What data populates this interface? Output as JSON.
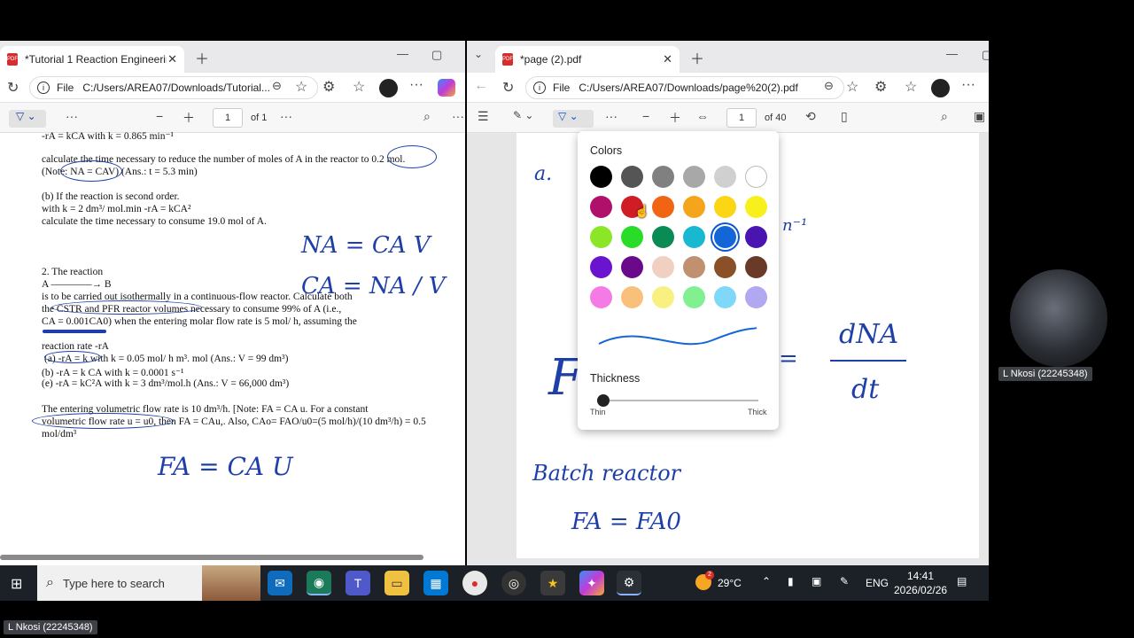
{
  "left_window": {
    "tab_title": "*Tutorial 1 Reaction Engineering (",
    "address_label": "File",
    "address": "C:/Users/AREA07/Downloads/Tutorial...",
    "page_current": "1",
    "page_total": "of 1"
  },
  "right_window": {
    "tab_title": "*page (2).pdf",
    "address_label": "File",
    "address": "C:/Users/AREA07/Downloads/page%20(2).pdf",
    "page_current": "1",
    "page_total": "of 40"
  },
  "left_doc": {
    "lines": [
      "-rA = kCA with k = 0.865 min⁻¹",
      "calculate the time necessary to reduce the number of moles of A in the reactor to 0.2 mol.",
      "(Note: NA = CAV) (Ans.: t = 5.3 min)",
      "(b) If the reaction is second order.",
      "with k = 2 dm³/ mol.min    -rA = kCA²",
      "calculate the time necessary to consume 19.0 mol of A.",
      "2. The reaction",
      "A ————→ B",
      "is to be carried out isothermally in a continuous-flow reactor. Calculate both",
      "the CSTR and PFR reactor volumes necessary to consume 99% of A (i.e.,",
      "CA = 0.001CA0) when the entering molar flow rate is 5 mol/ h, assuming the",
      "reaction rate -rA",
      "(a) -rA = k        with k = 0.05 mol/ h m³.    mol (Ans.: V = 99 dm³)",
      "(b) -rA = k CA  with k = 0.0001 s⁻¹",
      "(e) -rA = kC²A with k = 3 dm³/mol.h   (Ans.: V = 66,000 dm³)",
      "The entering volumetric flow rate is 10 dm³/h. [Note: FA = CA u. For a constant",
      "volumetric flow rate u = u0, then FA = CAu,. Also, CAo= FAO/u0=(5 mol/h)/(10 dm³/h) = 0.5",
      "mol/dm³"
    ],
    "hand": [
      "NA = CA V",
      "CA = NA / V",
      "FA = CA U"
    ]
  },
  "right_doc": {
    "hand": [
      "a.",
      "n⁻¹",
      "dNA",
      "dt",
      "= ",
      "Batch reactor",
      "FA = FA0",
      "F"
    ]
  },
  "popup": {
    "colors_label": "Colors",
    "thickness_label": "Thickness",
    "thin": "Thin",
    "thick": "Thick",
    "thickness_value": 0,
    "swatches": [
      [
        "#000000",
        "#555555",
        "#808080",
        "#a8a8a8",
        "#d0d0d0",
        "#ffffff"
      ],
      [
        "#b0106a",
        "#d01c24",
        "#f06414",
        "#f5a51c",
        "#fad614",
        "#f8f01c"
      ],
      [
        "#8ce628",
        "#28dc28",
        "#0a8a55",
        "#18b8d0",
        "#1466d8",
        "#4a14b0"
      ],
      [
        "#6a14d0",
        "#6a0a8a",
        "#f0d0c0",
        "#c09070",
        "#8a5028",
        "#6a3a28"
      ],
      [
        "#f47ae6",
        "#f8c07a",
        "#f8f080",
        "#80f090",
        "#80d8f8",
        "#b0a8f0"
      ]
    ],
    "selected_color": "#1466d8"
  },
  "webcam": {
    "name": "L Nkosi (22245348)"
  },
  "bottom_name": "L Nkosi (22245348)",
  "taskbar": {
    "search_placeholder": "Type here to search",
    "temperature": "29°C",
    "language": "ENG",
    "time": "14:41",
    "date": "2026/02/26",
    "weather_badge": "2"
  }
}
